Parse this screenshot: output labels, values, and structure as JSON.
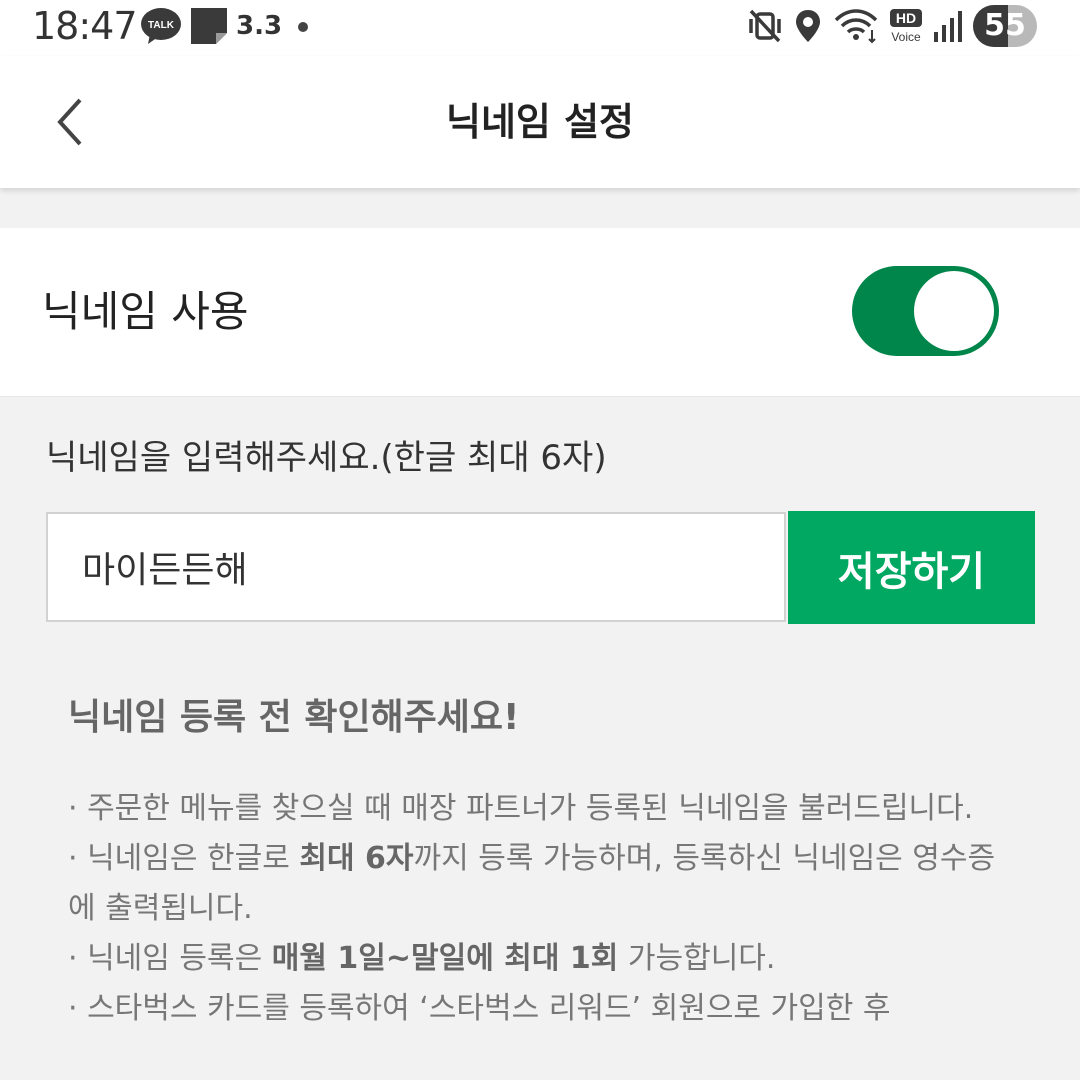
{
  "status_bar": {
    "time": "18:47",
    "talk_label": "TALK",
    "notification_number": "3.3",
    "hd_label": "HD",
    "voice_label": "Voice",
    "battery": "55",
    "icons": [
      "talk-icon",
      "note-icon",
      "mute-vibrate-icon",
      "location-icon",
      "wifi-icon",
      "hd-voice-icon",
      "signal-icon",
      "battery-icon"
    ]
  },
  "header": {
    "title": "닉네임 설정",
    "back_icon": "chevron-left-icon"
  },
  "nickname_toggle": {
    "label": "닉네임 사용",
    "on": true,
    "on_color": "#00854a"
  },
  "input_section": {
    "caption": "닉네임을 입력해주세요.(한글 최대 6자)",
    "value": "마이든든해",
    "save_label": "저장하기",
    "save_color": "#00a862"
  },
  "notice": {
    "title": "닉네임 등록 전 확인해주세요!",
    "item1": "· 주문한 메뉴를 찾으실 때 매장 파트너가 등록된 닉네임을 불러드립니다.",
    "item2_before": "· 닉네임은 한글로 ",
    "item2_bold": "최대 6자",
    "item2_after": "까지 등록 가능하며, 등록하신 닉네임은 영수증에 출력됩니다.",
    "item3_before": "· 닉네임 등록은 ",
    "item3_bold": "매월 1일~말일에 최대 1회",
    "item3_after": " 가능합니다.",
    "item4": "· 스타벅스 카드를 등록하여 ‘스타벅스 리워드’ 회원으로 가입한 후"
  }
}
